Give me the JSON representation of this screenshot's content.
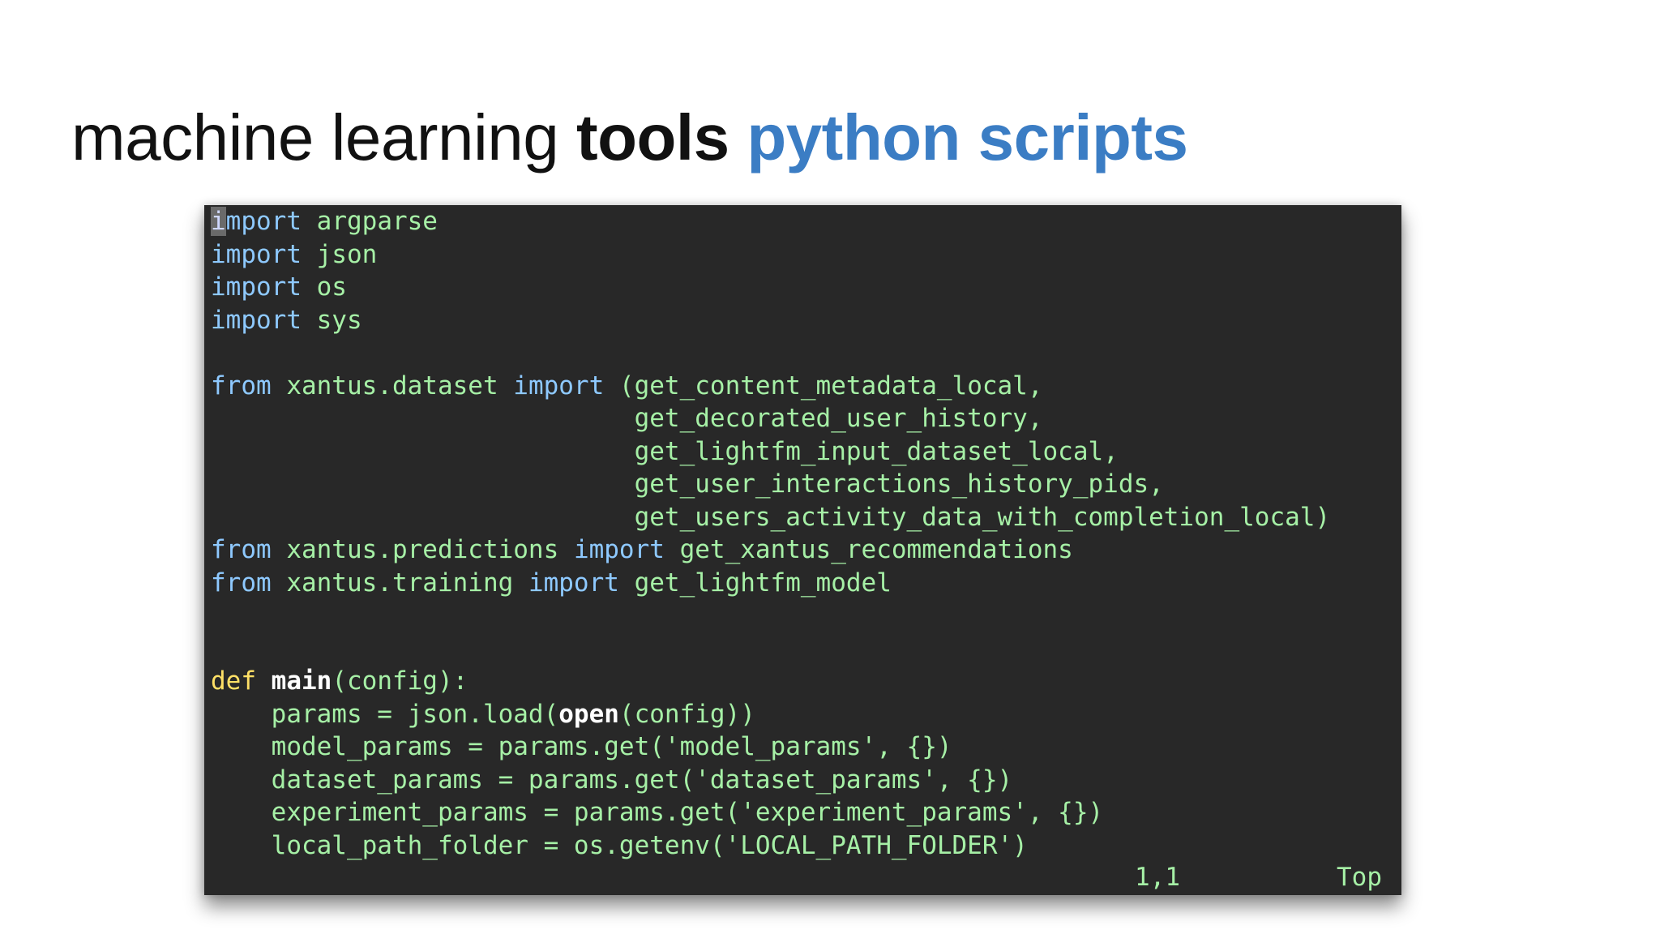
{
  "slide": {
    "title_part1": "machine learning ",
    "title_part2": "tools",
    "title_part3": "python scripts"
  },
  "colors": {
    "accent": "#3b7dc4",
    "terminal_bg": "#282828",
    "keyword": "#8ec9ff",
    "def_keyword": "#ffe066",
    "code_text": "#a6f0a6"
  },
  "editor": {
    "lines": [
      [
        {
          "t": "i",
          "c": "cursor"
        },
        {
          "t": "mport",
          "c": "kw"
        },
        {
          "t": " argparse",
          "c": "plain"
        }
      ],
      [
        {
          "t": "import",
          "c": "kw"
        },
        {
          "t": " json",
          "c": "plain"
        }
      ],
      [
        {
          "t": "import",
          "c": "kw"
        },
        {
          "t": " os",
          "c": "plain"
        }
      ],
      [
        {
          "t": "import",
          "c": "kw"
        },
        {
          "t": " sys",
          "c": "plain"
        }
      ],
      [],
      [
        {
          "t": "from",
          "c": "kw"
        },
        {
          "t": " xantus.dataset ",
          "c": "plain"
        },
        {
          "t": "import",
          "c": "kw"
        },
        {
          "t": " (get_content_metadata_local,",
          "c": "plain"
        }
      ],
      [
        {
          "t": "                            get_decorated_user_history,",
          "c": "plain"
        }
      ],
      [
        {
          "t": "                            get_lightfm_input_dataset_local,",
          "c": "plain"
        }
      ],
      [
        {
          "t": "                            get_user_interactions_history_pids,",
          "c": "plain"
        }
      ],
      [
        {
          "t": "                            get_users_activity_data_with_completion_local)",
          "c": "plain"
        }
      ],
      [
        {
          "t": "from",
          "c": "kw"
        },
        {
          "t": " xantus.predictions ",
          "c": "plain"
        },
        {
          "t": "import",
          "c": "kw"
        },
        {
          "t": " get_xantus_recommendations",
          "c": "plain"
        }
      ],
      [
        {
          "t": "from",
          "c": "kw"
        },
        {
          "t": " xantus.training ",
          "c": "plain"
        },
        {
          "t": "import",
          "c": "kw"
        },
        {
          "t": " get_lightfm_model",
          "c": "plain"
        }
      ],
      [],
      [],
      [
        {
          "t": "def",
          "c": "def"
        },
        {
          "t": " ",
          "c": "plain"
        },
        {
          "t": "main",
          "c": "fn-bold"
        },
        {
          "t": "(config):",
          "c": "plain"
        }
      ],
      [
        {
          "t": "    params = json.load(",
          "c": "plain"
        },
        {
          "t": "open",
          "c": "fn-bold"
        },
        {
          "t": "(config))",
          "c": "plain"
        }
      ],
      [
        {
          "t": "    model_params = params.get('model_params', {})",
          "c": "plain"
        }
      ],
      [
        {
          "t": "    dataset_params = params.get('dataset_params', {})",
          "c": "plain"
        }
      ],
      [
        {
          "t": "    experiment_params = params.get('experiment_params', {})",
          "c": "plain"
        }
      ],
      [
        {
          "t": "    local_path_folder = os.getenv('LOCAL_PATH_FOLDER')",
          "c": "plain"
        }
      ]
    ],
    "status_position": "1,1",
    "status_scroll": "Top"
  }
}
